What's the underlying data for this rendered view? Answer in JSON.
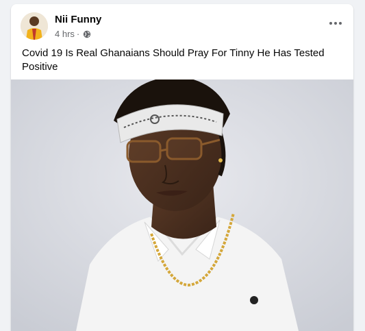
{
  "post": {
    "author": "Nii Funny",
    "time": "4 hrs",
    "separator": "·",
    "audience_icon": "globe-icon",
    "more_icon": "more-dots-icon",
    "caption": "Covid 19 Is Real Ghanaians Should Pray For Tinny He Has Tested Positive",
    "image_alt": "Man wearing bandana headband, glasses and white polo shirt with gold chain"
  },
  "colors": {
    "background": "#f0f2f5",
    "card": "#ffffff",
    "text_primary": "#050505",
    "text_secondary": "#65676b"
  }
}
